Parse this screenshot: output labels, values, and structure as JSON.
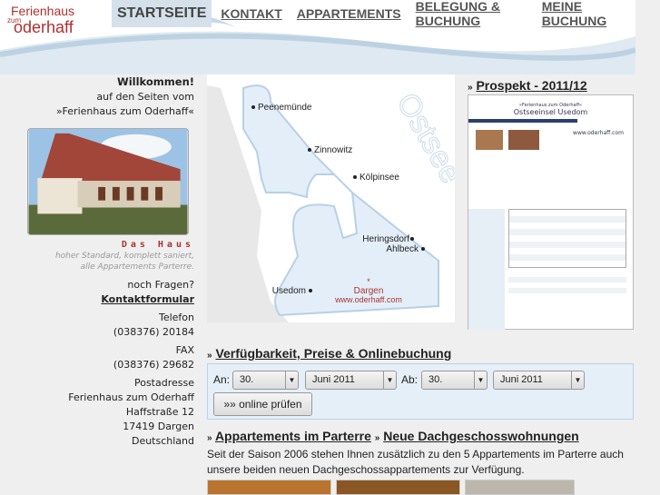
{
  "logo": {
    "line1": "Ferienhaus",
    "line2": "zum",
    "line3": "oderhaff"
  },
  "nav": [
    "STARTSEITE",
    "KONTAKT",
    "APPARTEMENTS",
    "BELEGUNG & BUCHUNG",
    "MEINE BUCHUNG"
  ],
  "left": {
    "welcome": "Willkommen!",
    "line2": "auf den Seiten vom",
    "line3": "»Ferienhaus zum Oderhaff«",
    "caption_title": "Das Haus",
    "caption_1": "hoher Standard, komplett saniert,",
    "caption_2": "alle Appartements Parterre.",
    "questions": "noch Fragen?",
    "contact_link": "Kontaktformular",
    "phone_label": "Telefon",
    "phone": "(038376) 20184",
    "fax_label": "FAX",
    "fax": "(038376) 29682",
    "address_label": "Postadresse",
    "addr1": "Ferienhaus zum Oderhaff",
    "addr2": "Haffstraße 12",
    "addr3": "17419 Dargen",
    "addr4": "Deutschland"
  },
  "map": {
    "sea": "Ostsee",
    "places": [
      "Peenemünde",
      "Zinnowitz",
      "Kölpinsee",
      "Heringsdorf",
      "Ahlbeck",
      "Usedom"
    ],
    "home": "Dargen",
    "url": "www.oderhaff.com"
  },
  "prospekt": {
    "arrow": "»",
    "title": "Prospekt - 2011/12",
    "header": "»Ferienhaus zum Oderhaff«",
    "subtitle": "Ostseeinsel Usedom",
    "url": "www.oderhaff.com"
  },
  "booking": {
    "arrow": "»",
    "title": "Verfügbarkeit, Preise & Onlinebuchung",
    "an_label": "An:",
    "ab_label": "Ab:",
    "an_day": "30.",
    "an_month": "Juni 2011",
    "ab_day": "30.",
    "ab_month": "Juni 2011",
    "check_button": "»» online prüfen"
  },
  "apartments": {
    "arrow": "»",
    "link1": "Appartements im Parterre",
    "link2": "Neue Dachgeschosswohnungen",
    "text": "Seit der Saison 2006 stehen Ihnen zusätzlich zu den 5 Appartements im Parterre auch unsere beiden neuen Dachgeschossappartements zur Verfügung."
  }
}
